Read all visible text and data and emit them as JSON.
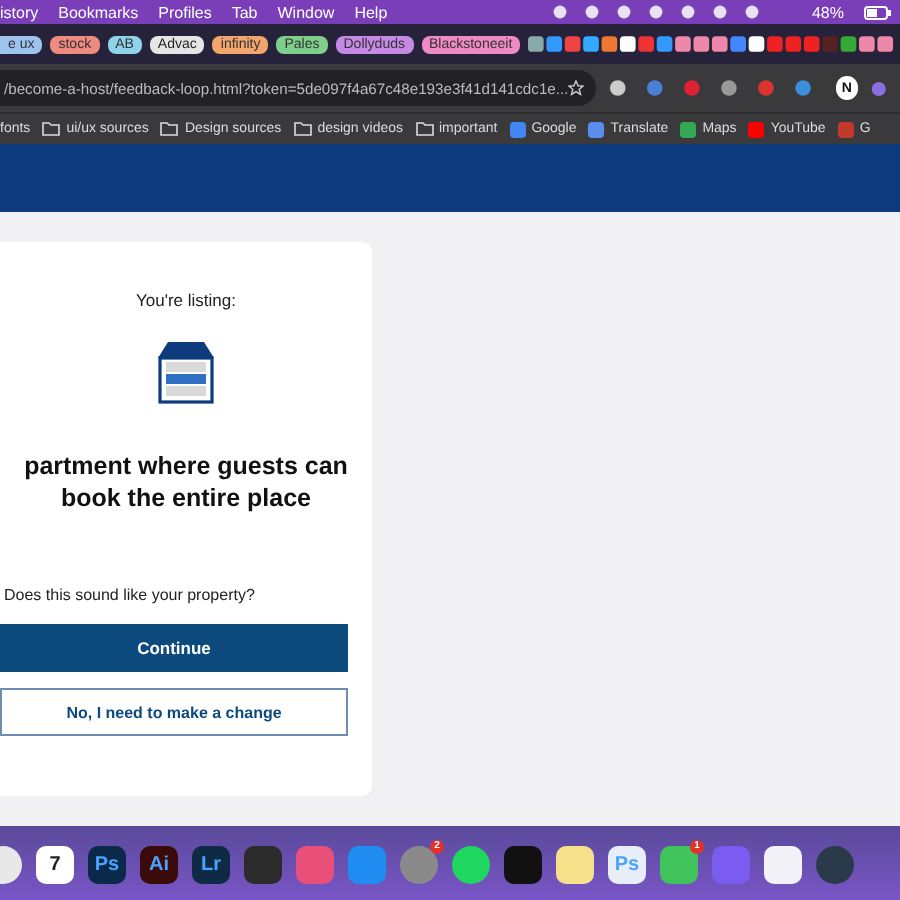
{
  "menu_bar": {
    "items": [
      "istory",
      "Bookmarks",
      "Profiles",
      "Tab",
      "Window",
      "Help"
    ],
    "battery": "48%"
  },
  "tab_groups": [
    {
      "label": "e ux",
      "color": "#9cc4ee"
    },
    {
      "label": "stock",
      "color": "#ee8a80"
    },
    {
      "label": "AB",
      "color": "#8ed3ea"
    },
    {
      "label": "Advac",
      "color": "#e6e6e6"
    },
    {
      "label": "infinity",
      "color": "#f2a66e"
    },
    {
      "label": "Pales",
      "color": "#7fcf8c"
    },
    {
      "label": "Dollyduds",
      "color": "#c68ae6"
    },
    {
      "label": "Blackstoneeit",
      "color": "#f08ac6"
    }
  ],
  "address_bar": {
    "url": "/become-a-host/feedback-loop.html?token=5de097f4a67c48e193e3f41d141cdc1e...",
    "profile": "N"
  },
  "bookmarks": [
    {
      "label": "fonts",
      "kind": "plain"
    },
    {
      "label": "ui/ux sources",
      "kind": "folder"
    },
    {
      "label": "Design sources",
      "kind": "folder"
    },
    {
      "label": "design videos",
      "kind": "folder"
    },
    {
      "label": "important",
      "kind": "folder"
    },
    {
      "label": "Google",
      "kind": "site",
      "color": "#4285f4"
    },
    {
      "label": "Translate",
      "kind": "site",
      "color": "#5b8def"
    },
    {
      "label": "Maps",
      "kind": "site",
      "color": "#34a853"
    },
    {
      "label": "YouTube",
      "kind": "site",
      "color": "#ff0000"
    },
    {
      "label": "G",
      "kind": "site",
      "color": "#c0392b"
    }
  ],
  "card": {
    "caption": "You're listing:",
    "title": [
      "partment where guests can",
      "book the entire place"
    ],
    "question": "Does this sound like your property?",
    "primary_button": "Continue",
    "secondary_button": "No, I need to make a change"
  },
  "dock": [
    {
      "kind": "round",
      "color": "#e8e8e8"
    },
    {
      "kind": "calendar",
      "label": "7",
      "color": "#ffffff"
    },
    {
      "kind": "text",
      "label": "Ps",
      "color": "#0b2a4a"
    },
    {
      "kind": "text",
      "label": "Ai",
      "color": "#3b0a0a"
    },
    {
      "kind": "text",
      "label": "Lr",
      "color": "#0f2a44"
    },
    {
      "kind": "plain",
      "color": "#2b2b2b"
    },
    {
      "kind": "plain",
      "color": "#e8507a"
    },
    {
      "kind": "plain",
      "color": "#1e8cf0"
    },
    {
      "kind": "round",
      "color": "#8a8a8a",
      "badge": "2"
    },
    {
      "kind": "round",
      "color": "#1ed760"
    },
    {
      "kind": "plain",
      "color": "#111111"
    },
    {
      "kind": "plain",
      "color": "#f6e08a"
    },
    {
      "kind": "text",
      "label": "Ps",
      "color": "#e8eef8"
    },
    {
      "kind": "plain",
      "color": "#3fc35a",
      "badge": "1"
    },
    {
      "kind": "plain",
      "color": "#7b5cf0"
    },
    {
      "kind": "plain",
      "color": "#f2f2f8"
    },
    {
      "kind": "round",
      "color": "#2a3a4a"
    }
  ]
}
